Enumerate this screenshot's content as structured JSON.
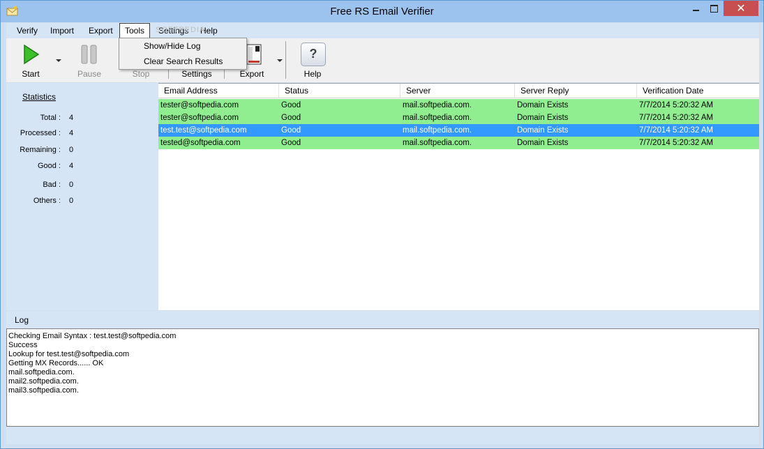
{
  "window": {
    "title": "Free RS Email Verifier",
    "close_glyph": "✕"
  },
  "menu": [
    {
      "label": "Verify"
    },
    {
      "label": "Import"
    },
    {
      "label": "Export"
    },
    {
      "label": "Tools"
    },
    {
      "label": "Settings"
    },
    {
      "label": "Help"
    }
  ],
  "tools_menu": {
    "items": [
      {
        "label": "Show/Hide Log"
      },
      {
        "label": "Clear Search Results"
      }
    ]
  },
  "watermark": "SOFTPEDIA",
  "toolbar": {
    "start": {
      "label": "Start",
      "icon": "play-icon"
    },
    "pause": {
      "label": "Pause",
      "icon": "pause-icon"
    },
    "stop": {
      "label": "Stop",
      "icon": "stop-icon"
    },
    "settings": {
      "label": "Settings",
      "icon": "settings-icon"
    },
    "export": {
      "label": "Export",
      "icon": "export-icon"
    },
    "help": {
      "label": "Help",
      "icon": "help-icon"
    },
    "help_glyph": "?"
  },
  "statistics": {
    "title": "Statistics",
    "rows": [
      {
        "label": "Total :",
        "value": "4"
      },
      {
        "label": "Processed :",
        "value": "4"
      },
      {
        "label": "Remaining :",
        "value": "0"
      },
      {
        "label": "Good :",
        "value": "4"
      },
      {
        "label": "Bad :",
        "value": "0"
      },
      {
        "label": "Others :",
        "value": "0"
      }
    ]
  },
  "grid": {
    "columns": [
      "Email Address",
      "Status",
      "Server",
      "Server Reply",
      "Verification Date"
    ],
    "rows": [
      {
        "email": "tester@softpedia.com",
        "status": "Good",
        "server": "mail.softpedia.com.",
        "reply": "Domain Exists",
        "date": "7/7/2014 5:20:32 AM"
      },
      {
        "email": "tester@softpedia.com",
        "status": "Good",
        "server": "mail.softpedia.com.",
        "reply": "Domain Exists",
        "date": "7/7/2014 5:20:32 AM"
      },
      {
        "email": "test.test@softpedia.com",
        "status": "Good",
        "server": "mail.softpedia.com.",
        "reply": "Domain Exists",
        "date": "7/7/2014 5:20:32 AM"
      },
      {
        "email": "tested@softpedia.com",
        "status": "Good",
        "server": "mail.softpedia.com.",
        "reply": "Domain Exists",
        "date": "7/7/2014 5:20:32 AM"
      }
    ]
  },
  "log": {
    "title": "Log",
    "lines": [
      "Checking Email Syntax : test.test@softpedia.com",
      "Success",
      "Lookup for test.test@softpedia.com",
      "Getting MX Records...... OK",
      "mail.softpedia.com.",
      "mail2.softpedia.com.",
      "mail3.softpedia.com."
    ]
  },
  "colors": {
    "good_row": "#90ee90",
    "selected_row": "#3399ff",
    "panel": "#d6e5f5",
    "titlebar": "#9bc3ed",
    "close_button": "#c74f4f"
  }
}
